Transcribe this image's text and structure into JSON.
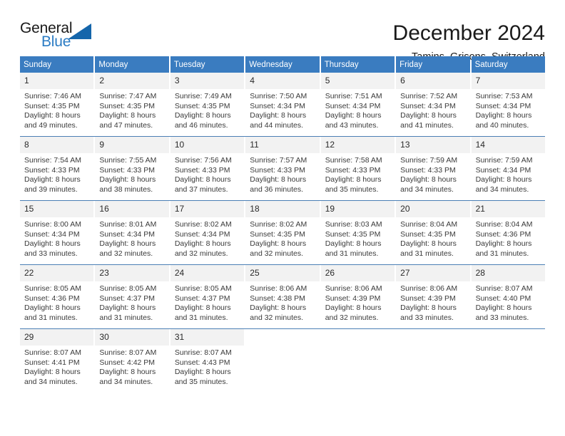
{
  "brand": {
    "name_top": "General",
    "name_bottom": "Blue",
    "triangle_icon": "triangle-icon",
    "accent_color": "#2b7cc4",
    "triangle_color": "#1566ab"
  },
  "header": {
    "title": "December 2024",
    "subtitle": "Tamins, Grisons, Switzerland"
  },
  "calendar": {
    "header_bg": "#3a7cc0",
    "daynum_bg": "#f2f2f2",
    "weekdays": [
      "Sunday",
      "Monday",
      "Tuesday",
      "Wednesday",
      "Thursday",
      "Friday",
      "Saturday"
    ],
    "weeks": [
      [
        {
          "day": "1",
          "sunrise": "Sunrise: 7:46 AM",
          "sunset": "Sunset: 4:35 PM",
          "daylight1": "Daylight: 8 hours",
          "daylight2": "and 49 minutes."
        },
        {
          "day": "2",
          "sunrise": "Sunrise: 7:47 AM",
          "sunset": "Sunset: 4:35 PM",
          "daylight1": "Daylight: 8 hours",
          "daylight2": "and 47 minutes."
        },
        {
          "day": "3",
          "sunrise": "Sunrise: 7:49 AM",
          "sunset": "Sunset: 4:35 PM",
          "daylight1": "Daylight: 8 hours",
          "daylight2": "and 46 minutes."
        },
        {
          "day": "4",
          "sunrise": "Sunrise: 7:50 AM",
          "sunset": "Sunset: 4:34 PM",
          "daylight1": "Daylight: 8 hours",
          "daylight2": "and 44 minutes."
        },
        {
          "day": "5",
          "sunrise": "Sunrise: 7:51 AM",
          "sunset": "Sunset: 4:34 PM",
          "daylight1": "Daylight: 8 hours",
          "daylight2": "and 43 minutes."
        },
        {
          "day": "6",
          "sunrise": "Sunrise: 7:52 AM",
          "sunset": "Sunset: 4:34 PM",
          "daylight1": "Daylight: 8 hours",
          "daylight2": "and 41 minutes."
        },
        {
          "day": "7",
          "sunrise": "Sunrise: 7:53 AM",
          "sunset": "Sunset: 4:34 PM",
          "daylight1": "Daylight: 8 hours",
          "daylight2": "and 40 minutes."
        }
      ],
      [
        {
          "day": "8",
          "sunrise": "Sunrise: 7:54 AM",
          "sunset": "Sunset: 4:33 PM",
          "daylight1": "Daylight: 8 hours",
          "daylight2": "and 39 minutes."
        },
        {
          "day": "9",
          "sunrise": "Sunrise: 7:55 AM",
          "sunset": "Sunset: 4:33 PM",
          "daylight1": "Daylight: 8 hours",
          "daylight2": "and 38 minutes."
        },
        {
          "day": "10",
          "sunrise": "Sunrise: 7:56 AM",
          "sunset": "Sunset: 4:33 PM",
          "daylight1": "Daylight: 8 hours",
          "daylight2": "and 37 minutes."
        },
        {
          "day": "11",
          "sunrise": "Sunrise: 7:57 AM",
          "sunset": "Sunset: 4:33 PM",
          "daylight1": "Daylight: 8 hours",
          "daylight2": "and 36 minutes."
        },
        {
          "day": "12",
          "sunrise": "Sunrise: 7:58 AM",
          "sunset": "Sunset: 4:33 PM",
          "daylight1": "Daylight: 8 hours",
          "daylight2": "and 35 minutes."
        },
        {
          "day": "13",
          "sunrise": "Sunrise: 7:59 AM",
          "sunset": "Sunset: 4:33 PM",
          "daylight1": "Daylight: 8 hours",
          "daylight2": "and 34 minutes."
        },
        {
          "day": "14",
          "sunrise": "Sunrise: 7:59 AM",
          "sunset": "Sunset: 4:34 PM",
          "daylight1": "Daylight: 8 hours",
          "daylight2": "and 34 minutes."
        }
      ],
      [
        {
          "day": "15",
          "sunrise": "Sunrise: 8:00 AM",
          "sunset": "Sunset: 4:34 PM",
          "daylight1": "Daylight: 8 hours",
          "daylight2": "and 33 minutes."
        },
        {
          "day": "16",
          "sunrise": "Sunrise: 8:01 AM",
          "sunset": "Sunset: 4:34 PM",
          "daylight1": "Daylight: 8 hours",
          "daylight2": "and 32 minutes."
        },
        {
          "day": "17",
          "sunrise": "Sunrise: 8:02 AM",
          "sunset": "Sunset: 4:34 PM",
          "daylight1": "Daylight: 8 hours",
          "daylight2": "and 32 minutes."
        },
        {
          "day": "18",
          "sunrise": "Sunrise: 8:02 AM",
          "sunset": "Sunset: 4:35 PM",
          "daylight1": "Daylight: 8 hours",
          "daylight2": "and 32 minutes."
        },
        {
          "day": "19",
          "sunrise": "Sunrise: 8:03 AM",
          "sunset": "Sunset: 4:35 PM",
          "daylight1": "Daylight: 8 hours",
          "daylight2": "and 31 minutes."
        },
        {
          "day": "20",
          "sunrise": "Sunrise: 8:04 AM",
          "sunset": "Sunset: 4:35 PM",
          "daylight1": "Daylight: 8 hours",
          "daylight2": "and 31 minutes."
        },
        {
          "day": "21",
          "sunrise": "Sunrise: 8:04 AM",
          "sunset": "Sunset: 4:36 PM",
          "daylight1": "Daylight: 8 hours",
          "daylight2": "and 31 minutes."
        }
      ],
      [
        {
          "day": "22",
          "sunrise": "Sunrise: 8:05 AM",
          "sunset": "Sunset: 4:36 PM",
          "daylight1": "Daylight: 8 hours",
          "daylight2": "and 31 minutes."
        },
        {
          "day": "23",
          "sunrise": "Sunrise: 8:05 AM",
          "sunset": "Sunset: 4:37 PM",
          "daylight1": "Daylight: 8 hours",
          "daylight2": "and 31 minutes."
        },
        {
          "day": "24",
          "sunrise": "Sunrise: 8:05 AM",
          "sunset": "Sunset: 4:37 PM",
          "daylight1": "Daylight: 8 hours",
          "daylight2": "and 31 minutes."
        },
        {
          "day": "25",
          "sunrise": "Sunrise: 8:06 AM",
          "sunset": "Sunset: 4:38 PM",
          "daylight1": "Daylight: 8 hours",
          "daylight2": "and 32 minutes."
        },
        {
          "day": "26",
          "sunrise": "Sunrise: 8:06 AM",
          "sunset": "Sunset: 4:39 PM",
          "daylight1": "Daylight: 8 hours",
          "daylight2": "and 32 minutes."
        },
        {
          "day": "27",
          "sunrise": "Sunrise: 8:06 AM",
          "sunset": "Sunset: 4:39 PM",
          "daylight1": "Daylight: 8 hours",
          "daylight2": "and 33 minutes."
        },
        {
          "day": "28",
          "sunrise": "Sunrise: 8:07 AM",
          "sunset": "Sunset: 4:40 PM",
          "daylight1": "Daylight: 8 hours",
          "daylight2": "and 33 minutes."
        }
      ],
      [
        {
          "day": "29",
          "sunrise": "Sunrise: 8:07 AM",
          "sunset": "Sunset: 4:41 PM",
          "daylight1": "Daylight: 8 hours",
          "daylight2": "and 34 minutes."
        },
        {
          "day": "30",
          "sunrise": "Sunrise: 8:07 AM",
          "sunset": "Sunset: 4:42 PM",
          "daylight1": "Daylight: 8 hours",
          "daylight2": "and 34 minutes."
        },
        {
          "day": "31",
          "sunrise": "Sunrise: 8:07 AM",
          "sunset": "Sunset: 4:43 PM",
          "daylight1": "Daylight: 8 hours",
          "daylight2": "and 35 minutes."
        },
        {
          "day": "",
          "sunrise": "",
          "sunset": "",
          "daylight1": "",
          "daylight2": ""
        },
        {
          "day": "",
          "sunrise": "",
          "sunset": "",
          "daylight1": "",
          "daylight2": ""
        },
        {
          "day": "",
          "sunrise": "",
          "sunset": "",
          "daylight1": "",
          "daylight2": ""
        },
        {
          "day": "",
          "sunrise": "",
          "sunset": "",
          "daylight1": "",
          "daylight2": ""
        }
      ]
    ]
  }
}
